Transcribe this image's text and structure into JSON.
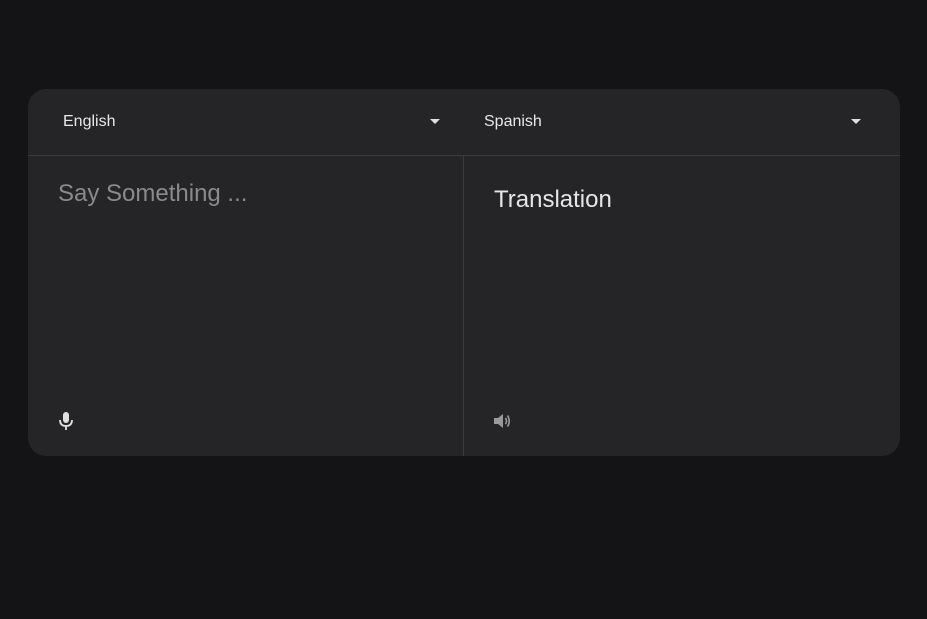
{
  "languages": {
    "source": "English",
    "target": "Spanish"
  },
  "source": {
    "placeholder": "Say Something ...",
    "value": ""
  },
  "target": {
    "text": "Translation"
  },
  "icons": {
    "source_action": "microphone-icon",
    "target_action": "speaker-icon",
    "dropdown": "caret-down-icon"
  },
  "colors": {
    "page_background": "#141416",
    "card_background": "#252527",
    "divider": "#3a3a3c",
    "text": "#e8e8e8",
    "placeholder": "#8a8a8c",
    "speaker_icon": "#9a9a9c"
  }
}
